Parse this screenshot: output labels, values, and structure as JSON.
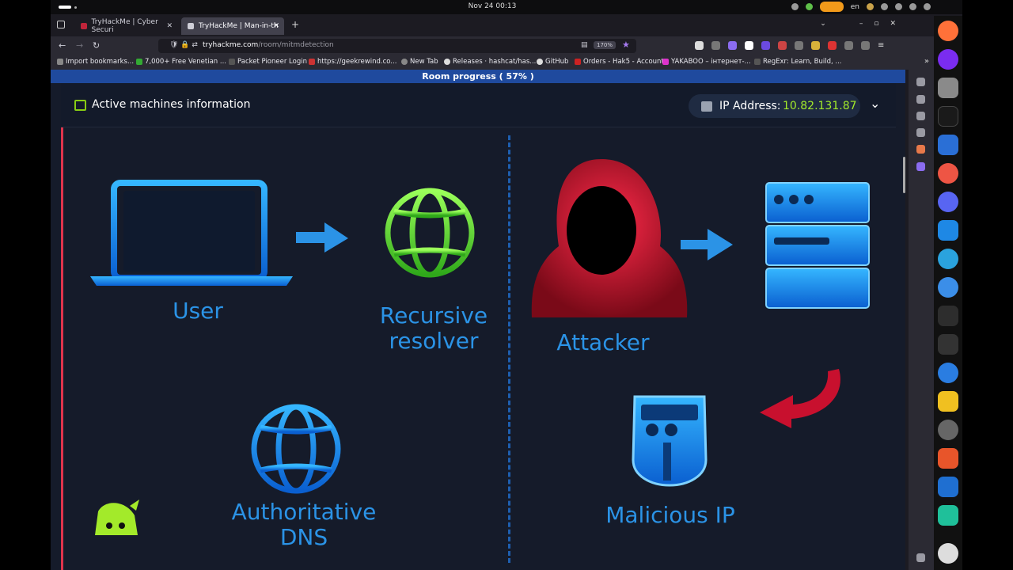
{
  "system": {
    "clock": "Nov 24  00:13",
    "language": "en"
  },
  "tabs": [
    {
      "label": "TryHackMe | Cyber Securi"
    },
    {
      "label": "TryHackMe | Man-in-th"
    }
  ],
  "nav": {
    "url_host": "tryhackme.com",
    "url_path": "/room/mitmdetection",
    "zoom": "170%"
  },
  "bookmarks": [
    "Import bookmarks...",
    "7,000+ Free Venetian ...",
    "Packet Pioneer Login",
    "https://geekrewind.co...",
    "New Tab",
    "Releases · hashcat/has...",
    "GitHub",
    "Orders - Hak5 - Account",
    "YAKABOO – інтернет-...",
    "RegExr: Learn, Build, ..."
  ],
  "page": {
    "room_progress": "Room progress ( 57% )",
    "machines_title": "Active machines information",
    "ip_label": "IP Address:",
    "ip_value": "10.82.131.87"
  },
  "diagram": {
    "user": "User",
    "recursive_1": "Recursive",
    "recursive_2": "resolver",
    "attacker": "Attacker",
    "auth_1": "Authoritative",
    "auth_2": "DNS",
    "malicious": "Malicious IP"
  },
  "colors": {
    "accent_green": "#a3ea2a",
    "label_blue": "#2b93e6",
    "progress_blue": "#1f4a9e",
    "attacker_red": "#c8102e"
  }
}
